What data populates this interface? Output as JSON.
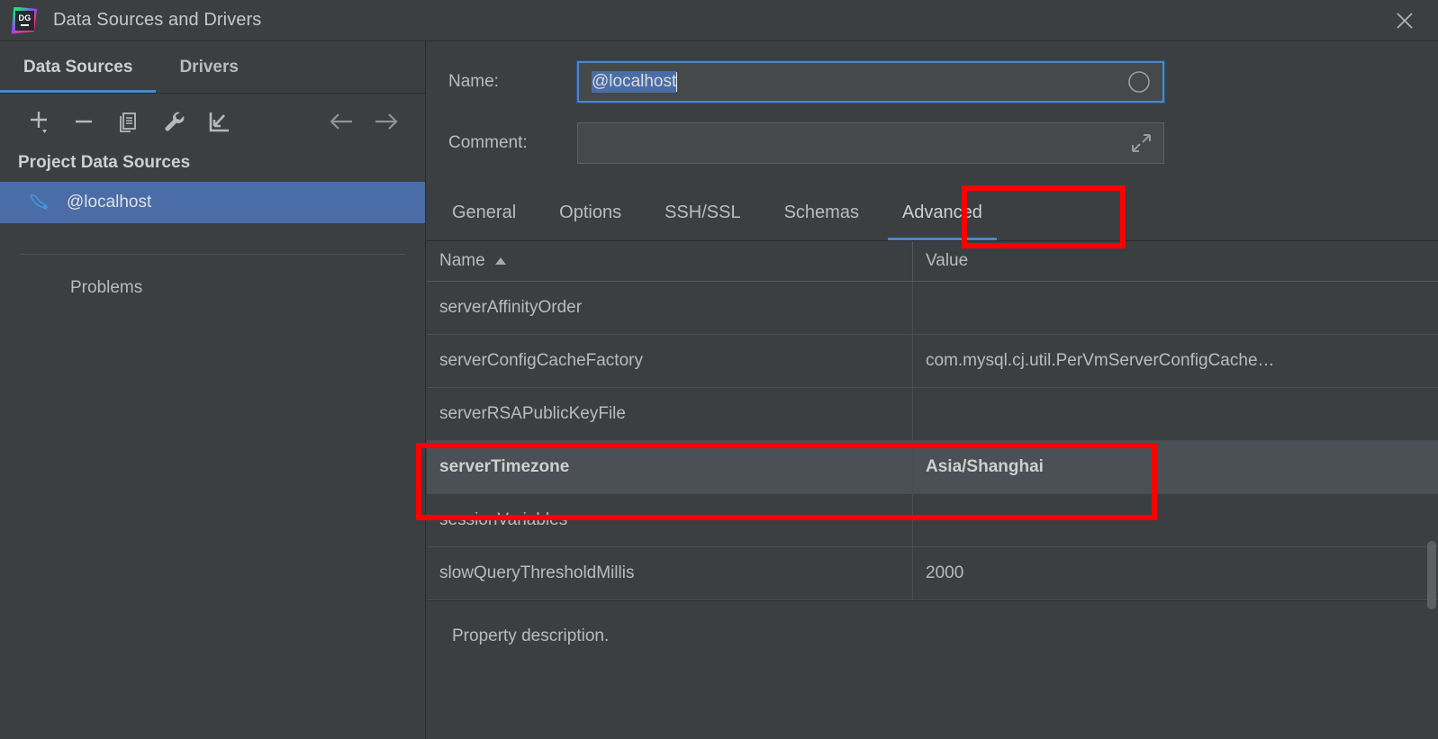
{
  "window": {
    "title": "Data Sources and Drivers",
    "logo_text": "DG",
    "close_icon": "close-icon"
  },
  "left_panel": {
    "tabs": [
      {
        "label": "Data Sources",
        "active": true
      },
      {
        "label": "Drivers",
        "active": false
      }
    ],
    "toolbar_icons": [
      "add-icon",
      "remove-icon",
      "copy-icon",
      "wrench-icon",
      "import-icon",
      "back-arrow-icon",
      "forward-arrow-icon"
    ],
    "section_label": "Project Data Sources",
    "data_sources": [
      {
        "label": "@localhost",
        "icon": "mysql-dolphin-icon",
        "selected": true
      }
    ],
    "problems_label": "Problems"
  },
  "form": {
    "name_label": "Name:",
    "name_value": "@localhost",
    "name_placeholder": "",
    "comment_label": "Comment:",
    "comment_value": "",
    "comment_placeholder": "",
    "name_field_icon": "circle-icon",
    "comment_field_icon": "expand-icon"
  },
  "tabs": [
    {
      "label": "General",
      "active": false
    },
    {
      "label": "Options",
      "active": false
    },
    {
      "label": "SSH/SSL",
      "active": false
    },
    {
      "label": "Schemas",
      "active": false
    },
    {
      "label": "Advanced",
      "active": true
    }
  ],
  "table": {
    "columns": [
      {
        "label": "Name",
        "sort": "ascending",
        "sort_icon": "sort-asc-icon"
      },
      {
        "label": "Value",
        "sort": "none"
      }
    ],
    "rows": [
      {
        "name": "serverAffinityOrder",
        "value": "",
        "bold": false,
        "selected": false
      },
      {
        "name": "serverConfigCacheFactory",
        "value": "com.mysql.cj.util.PerVmServerConfigCache…",
        "bold": false,
        "selected": false
      },
      {
        "name": "serverRSAPublicKeyFile",
        "value": "",
        "bold": false,
        "selected": false
      },
      {
        "name": "serverTimezone",
        "value": "Asia/Shanghai",
        "bold": true,
        "selected": true
      },
      {
        "name": "sessionVariables",
        "value": "",
        "bold": false,
        "selected": false
      },
      {
        "name": "slowQueryThresholdMillis",
        "value": "2000",
        "bold": false,
        "selected": false
      }
    ]
  },
  "description": {
    "text": "Property description."
  },
  "annotations": [
    {
      "name": "advanced-tab-highlight",
      "target": "Advanced"
    },
    {
      "name": "server-timezone-row-highlight",
      "target": "serverTimezone"
    }
  ],
  "colors": {
    "background": "#3c3f41",
    "selection_blue": "#4a6da7",
    "accent_blue": "#4a88c7",
    "annotation_red": "#ff0000",
    "row_selected": "#4b5056",
    "text": "#bbbbbb"
  }
}
